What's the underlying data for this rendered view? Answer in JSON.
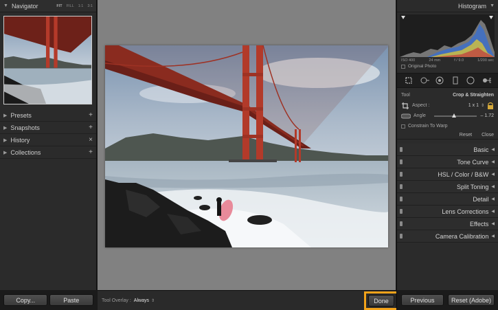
{
  "navigator": {
    "title": "Navigator",
    "zoom_options": [
      "FIT",
      "FILL",
      "1:1",
      "3:1"
    ]
  },
  "left_sections": [
    {
      "label": "Presets",
      "action": "+"
    },
    {
      "label": "Snapshots",
      "action": "+"
    },
    {
      "label": "History",
      "action": "×"
    },
    {
      "label": "Collections",
      "action": "+"
    }
  ],
  "left_buttons": {
    "copy": "Copy...",
    "paste": "Paste"
  },
  "toolbar": {
    "overlay_label": "Tool Overlay :",
    "overlay_value": "Always",
    "done": "Done"
  },
  "histogram": {
    "title": "Histogram",
    "iso": "ISO 400",
    "focal": "24 mm",
    "aperture": "f / 9.0",
    "shutter": "1/200 sec",
    "original_label": "Original Photo"
  },
  "crop": {
    "tool_label": "Tool",
    "tool_name": "Crop & Straighten",
    "aspect_label": "Aspect :",
    "aspect_value": "1 x 1",
    "angle_label": "Angle",
    "angle_value": "– 1.72",
    "constrain_label": "Constrain To Warp",
    "reset": "Reset",
    "close": "Close"
  },
  "sections": [
    {
      "label": "Basic"
    },
    {
      "label": "Tone Curve"
    },
    {
      "label": "HSL  /  Color  /  B&W"
    },
    {
      "label": "Split Toning"
    },
    {
      "label": "Detail"
    },
    {
      "label": "Lens Corrections"
    },
    {
      "label": "Effects"
    },
    {
      "label": "Camera Calibration"
    }
  ],
  "right_buttons": {
    "previous": "Previous",
    "reset": "Reset (Adobe)"
  },
  "colors": {
    "done_highlight": "#f3a31a",
    "bridge": "#b43a2a",
    "canvas_bg": "#818181"
  }
}
